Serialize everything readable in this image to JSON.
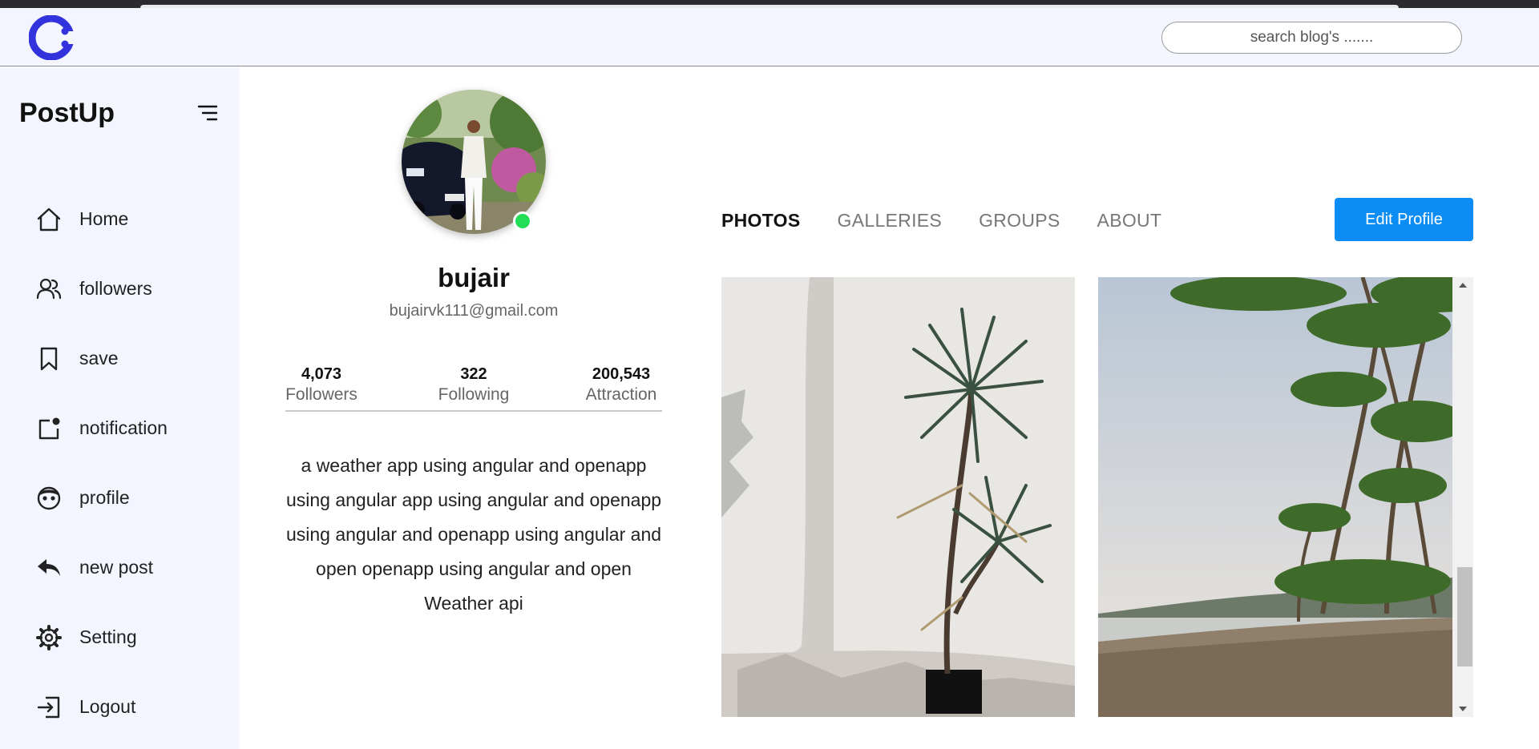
{
  "header": {
    "logo_icon": "c-logo-icon",
    "search_placeholder": "search blog's ......."
  },
  "sidebar": {
    "brand": "PostUp",
    "items": [
      {
        "label": "Home",
        "icon": "home-icon"
      },
      {
        "label": "followers",
        "icon": "users-icon"
      },
      {
        "label": "save",
        "icon": "bookmark-icon"
      },
      {
        "label": "notification",
        "icon": "notification-icon"
      },
      {
        "label": "profile",
        "icon": "face-icon"
      },
      {
        "label": "new post",
        "icon": "reply-icon"
      },
      {
        "label": "Setting",
        "icon": "gear-icon"
      },
      {
        "label": "Logout",
        "icon": "logout-icon"
      }
    ]
  },
  "profile": {
    "username": "bujair",
    "email": "bujairvk111@gmail.com",
    "stats": [
      {
        "value": "4,073",
        "caption": "Followers"
      },
      {
        "value": "322",
        "caption": "Following"
      },
      {
        "value": "200,543",
        "caption": "Attraction"
      }
    ],
    "bio": "a weather app using angular and openapp using angular app using angular and openapp using angular and openapp using angular and open openapp using angular and open Weather api",
    "online": true
  },
  "tabs": [
    {
      "label": "PHOTOS",
      "active": true
    },
    {
      "label": "GALLERIES",
      "active": false
    },
    {
      "label": "GROUPS",
      "active": false
    },
    {
      "label": "ABOUT",
      "active": false
    }
  ],
  "edit_profile_label": "Edit Profile",
  "colors": {
    "accent": "#0c8cf5",
    "online": "#22dd55",
    "logo": "#3333dd",
    "sidebar_bg": "#f3f6ff"
  }
}
